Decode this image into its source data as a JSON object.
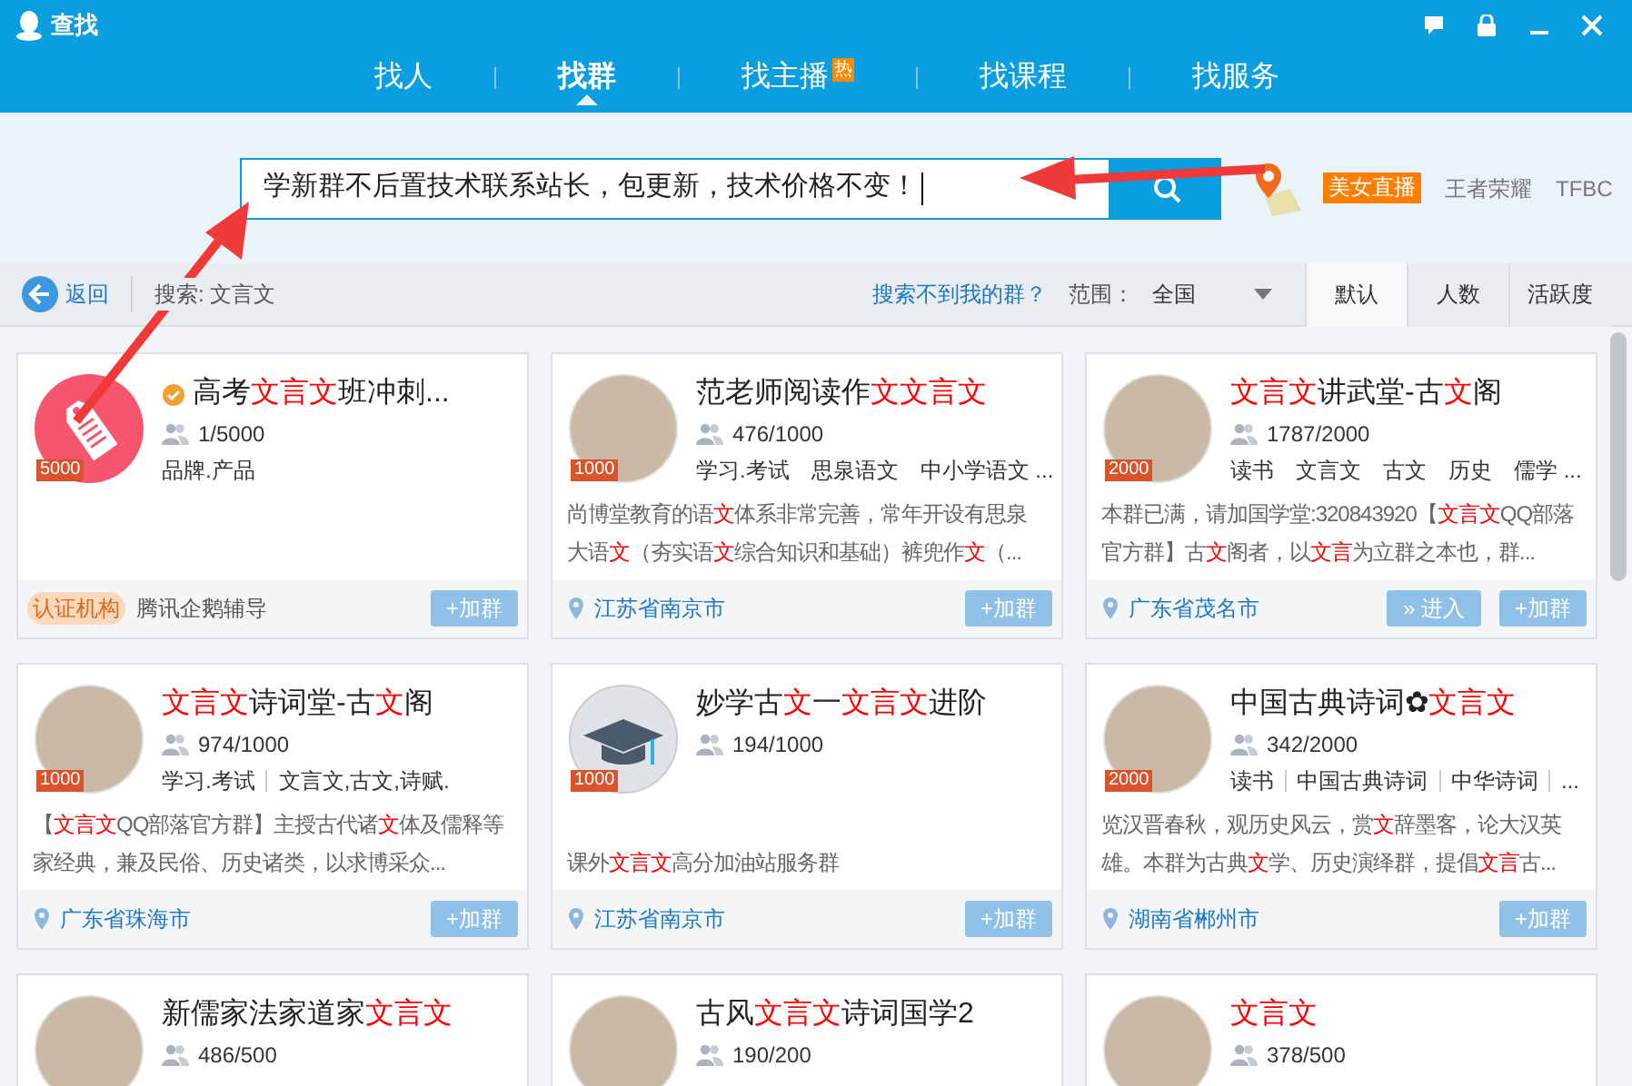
{
  "window": {
    "title": "查找"
  },
  "nav_tabs": [
    {
      "label": "找人",
      "selected": false
    },
    {
      "label": "找群",
      "selected": true
    },
    {
      "label": "找主播",
      "selected": false,
      "badge": "热"
    },
    {
      "label": "找课程",
      "selected": false
    },
    {
      "label": "找服务",
      "selected": false
    }
  ],
  "search": {
    "value": "学新群不后置技术联系站长，包更新，技术价格不变！"
  },
  "hot_tags": [
    {
      "label": "美女直播",
      "kind": "featured"
    },
    {
      "label": "王者荣耀",
      "kind": "plain"
    },
    {
      "label": "TFBC",
      "kind": "plain"
    }
  ],
  "toolbar": {
    "back": "返回",
    "query": "搜索: 文言文",
    "help_link": "搜索不到我的群？",
    "scope_label": "范围：",
    "scope_value": "全国",
    "sort_tabs": [
      {
        "label": "默认",
        "selected": true
      },
      {
        "label": "人数",
        "selected": false
      },
      {
        "label": "活跃度",
        "selected": false
      }
    ]
  },
  "cards": [
    {
      "avatar": {
        "kind": "tag-icon"
      },
      "level_badge": "5000",
      "verified": true,
      "title": [
        {
          "text": "高考"
        },
        {
          "text": "文言文",
          "highlight": true
        },
        {
          "text": "班冲刺..."
        }
      ],
      "members": "1/5000",
      "tags": [
        "品牌.产品"
      ],
      "footer": {
        "kind": "certified",
        "badge": "认证机构",
        "text": "腾讯企鹅辅导"
      },
      "buttons": [
        {
          "kind": "join",
          "label": "+加群"
        }
      ]
    },
    {
      "avatar": {
        "kind": "photo"
      },
      "level_badge": "1000",
      "verified": false,
      "title": [
        {
          "text": "范老师阅读作"
        },
        {
          "text": "文文言文",
          "highlight": true
        }
      ],
      "members": "476/1000",
      "tags": [
        "学习.考试",
        "思泉语文",
        "中小学语文 ..."
      ],
      "description": [
        {
          "text": "尚博堂教育的语"
        },
        {
          "text": "文",
          "highlight": true
        },
        {
          "text": "体系非常完善，常年开设有思泉大语"
        },
        {
          "text": "文",
          "highlight": true
        },
        {
          "text": "（夯实语"
        },
        {
          "text": "文",
          "highlight": true
        },
        {
          "text": "综合知识和基础）裤兜作"
        },
        {
          "text": "文",
          "highlight": true
        },
        {
          "text": "（..."
        }
      ],
      "footer": {
        "kind": "location",
        "text": "江苏省南京市"
      },
      "buttons": [
        {
          "kind": "join",
          "label": "+加群"
        }
      ]
    },
    {
      "avatar": {
        "kind": "photo"
      },
      "level_badge": "2000",
      "verified": false,
      "title": [
        {
          "text": "文言文",
          "highlight": true
        },
        {
          "text": "讲武堂-古"
        },
        {
          "text": "文",
          "highlight": true
        },
        {
          "text": "阁"
        }
      ],
      "members": "1787/2000",
      "tags": [
        "读书",
        "文言文",
        "古文",
        "历史",
        "儒学 ..."
      ],
      "description": [
        {
          "text": "本群已满，请加国学堂:320843920【"
        },
        {
          "text": "文言文",
          "highlight": true
        },
        {
          "text": "QQ部落官方群】古"
        },
        {
          "text": "文",
          "highlight": true
        },
        {
          "text": "阁者，以"
        },
        {
          "text": "文言",
          "highlight": true
        },
        {
          "text": "为立群之本也，群..."
        }
      ],
      "footer": {
        "kind": "location",
        "text": "广东省茂名市"
      },
      "buttons": [
        {
          "kind": "enter",
          "label": "» 进入"
        },
        {
          "kind": "join",
          "label": "+加群"
        }
      ]
    },
    {
      "avatar": {
        "kind": "photo"
      },
      "level_badge": "1000",
      "verified": false,
      "title": [
        {
          "text": "文言文",
          "highlight": true
        },
        {
          "text": "诗词堂-古"
        },
        {
          "text": "文",
          "highlight": true
        },
        {
          "text": "阁"
        }
      ],
      "members": "974/1000",
      "tags": [
        "学习.考试",
        "文言文,古文,诗赋."
      ],
      "description": [
        {
          "text": "【"
        },
        {
          "text": "文言文",
          "highlight": true
        },
        {
          "text": "QQ部落官方群】主授古代诸"
        },
        {
          "text": "文",
          "highlight": true
        },
        {
          "text": "体及儒释等家经典，兼及民俗、历史诸类，以求博采众..."
        }
      ],
      "footer": {
        "kind": "location",
        "text": "广东省珠海市"
      },
      "buttons": [
        {
          "kind": "join",
          "label": "+加群"
        }
      ]
    },
    {
      "avatar": {
        "kind": "cap-icon"
      },
      "level_badge": "1000",
      "verified": false,
      "title": [
        {
          "text": "妙学古"
        },
        {
          "text": "文",
          "highlight": true
        },
        {
          "text": "一"
        },
        {
          "text": "文言文",
          "highlight": true
        },
        {
          "text": "进阶"
        }
      ],
      "members": "194/1000",
      "description": [
        {
          "text": "课外"
        },
        {
          "text": "文言文",
          "highlight": true
        },
        {
          "text": "高分加油站服务群"
        }
      ],
      "footer": {
        "kind": "location",
        "text": "江苏省南京市"
      },
      "buttons": [
        {
          "kind": "join",
          "label": "+加群"
        }
      ]
    },
    {
      "avatar": {
        "kind": "photo"
      },
      "level_badge": "2000",
      "verified": false,
      "title": [
        {
          "text": "中国古典诗词✿"
        },
        {
          "text": "文言文",
          "highlight": true
        }
      ],
      "members": "342/2000",
      "tags": [
        "读书",
        "中国古典诗词",
        "中华诗词",
        "..."
      ],
      "description": [
        {
          "text": "览汉晋春秋，观历史风云，赏"
        },
        {
          "text": "文",
          "highlight": true
        },
        {
          "text": "辞墨客，论大汉英雄。本群为古典"
        },
        {
          "text": "文",
          "highlight": true
        },
        {
          "text": "学、历史演绎群，提倡"
        },
        {
          "text": "文言",
          "highlight": true
        },
        {
          "text": "古..."
        }
      ],
      "footer": {
        "kind": "location",
        "text": "湖南省郴州市"
      },
      "buttons": [
        {
          "kind": "join",
          "label": "+加群"
        }
      ]
    },
    {
      "avatar": {
        "kind": "photo"
      },
      "verified": false,
      "title": [
        {
          "text": "新儒家法家道家"
        },
        {
          "text": "文言文",
          "highlight": true
        }
      ],
      "members": "486/500"
    },
    {
      "avatar": {
        "kind": "photo"
      },
      "verified": false,
      "title": [
        {
          "text": "古风"
        },
        {
          "text": "文言文",
          "highlight": true
        },
        {
          "text": "诗词国学2"
        }
      ],
      "members": "190/200"
    },
    {
      "avatar": {
        "kind": "photo"
      },
      "verified": false,
      "title": [
        {
          "text": "文言文",
          "highlight": true
        }
      ],
      "members": "378/500"
    }
  ]
}
